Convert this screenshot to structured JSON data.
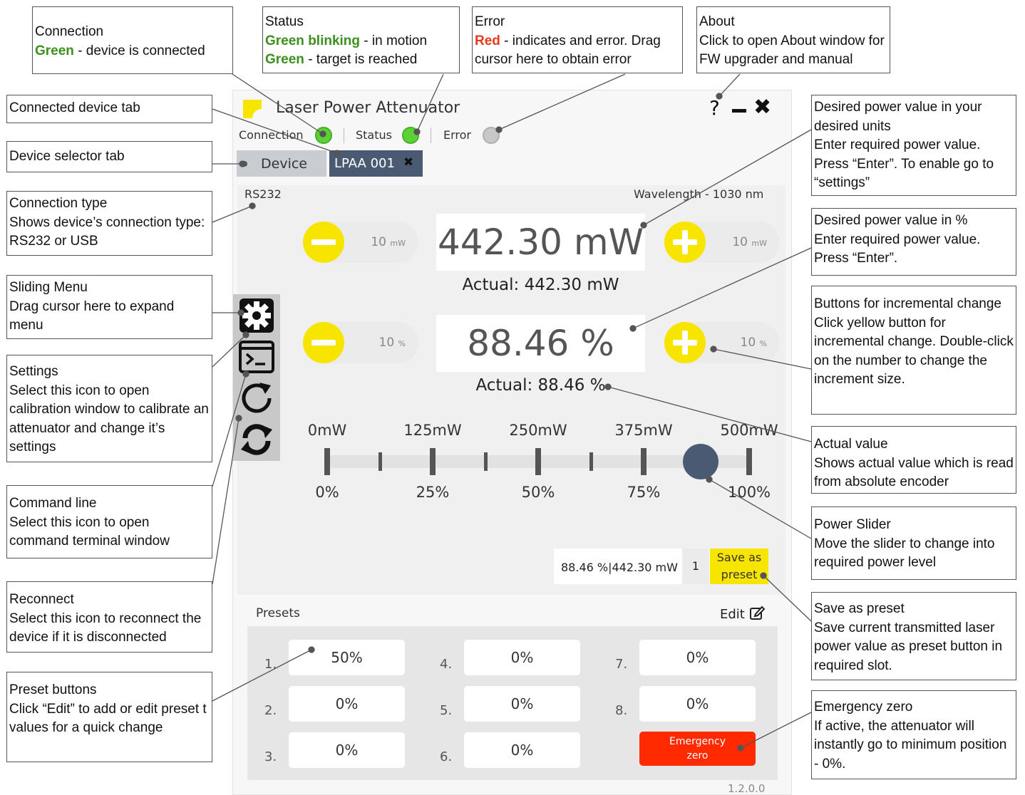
{
  "app": {
    "title": "Laser Power Attenuator",
    "help_glyph": "?",
    "indicators": {
      "connection_label": "Connection",
      "status_label": "Status",
      "error_label": "Error"
    },
    "tabs": {
      "device": "Device",
      "connected": "LPAA 001"
    },
    "connection_type": "RS232",
    "wavelength": "Wavelength - 1030 nm",
    "power": {
      "value": "442.30 mW",
      "actual": "Actual: 442.30 mW",
      "minus_step": "10",
      "plus_step": "10",
      "unit": "mW"
    },
    "percent": {
      "value": "88.46 %",
      "actual": "Actual: 88.46 %",
      "minus_step": "10",
      "plus_step": "10",
      "unit": "%"
    },
    "slider": {
      "top_labels": [
        "0mW",
        "125mW",
        "250mW",
        "375mW",
        "500mW"
      ],
      "bottom_labels": [
        "0%",
        "25%",
        "50%",
        "75%",
        "100%"
      ],
      "value_percent": 88.46
    },
    "save_bar": {
      "readout": "88.46 %|442.30 mW",
      "slot": "1",
      "save_label": "Save as preset"
    },
    "presets": {
      "title": "Presets",
      "edit_label": "Edit",
      "items": [
        {
          "num": "1.",
          "value": "50%"
        },
        {
          "num": "2.",
          "value": "0%"
        },
        {
          "num": "3.",
          "value": "0%"
        },
        {
          "num": "4.",
          "value": "0%"
        },
        {
          "num": "5.",
          "value": "0%"
        },
        {
          "num": "6.",
          "value": "0%"
        },
        {
          "num": "7.",
          "value": "0%"
        },
        {
          "num": "8.",
          "value": "0%"
        }
      ],
      "emergency_label": "Emergency zero"
    },
    "version": "1.2.0.0",
    "colors": {
      "yellow": "#f7e500",
      "green": "#5bd136",
      "error_grey": "#c8c8c8",
      "emergency": "#ff2a00",
      "tab_dark": "#4a5a72",
      "knob": "#4a5a72"
    }
  },
  "callouts": {
    "connection": {
      "title": "Connection",
      "green": "Green",
      "desc": " - device is connected"
    },
    "status": {
      "title": "Status",
      "green_blink": "Green blinking",
      "desc1": " - in motion",
      "green": "Green",
      "desc2": " - target is reached"
    },
    "error": {
      "title": "Error",
      "red": "Red",
      "desc": " - indicates and error. Drag cursor here to obtain error"
    },
    "about": {
      "title": "About",
      "desc": "Click to open About window for FW upgrader and manual"
    },
    "connected_tab": {
      "title": "Connected device tab"
    },
    "selector_tab": {
      "title": "Device selector tab"
    },
    "conn_type": {
      "title": "Connection type",
      "desc": "Shows device’s connection type: RS232 or USB"
    },
    "sliding_menu": {
      "title": "Sliding Menu",
      "desc": "Drag cursor here to expand menu"
    },
    "settings": {
      "title": "Settings",
      "desc": "Select this icon to open calibration window to calibrate an attenuator and change it’s settings"
    },
    "command_line": {
      "title": "Command line",
      "desc": "Select this icon to open command terminal window"
    },
    "reconnect": {
      "title": "Reconnect",
      "desc": "Select this icon to reconnect the device if it is disconnected"
    },
    "preset_buttons": {
      "title": "Preset buttons",
      "desc": "Click “Edit” to add or edit preset t values for a quick change"
    },
    "desired_units": {
      "title": "Desired power value in your desired units",
      "desc": "Enter required power value. Press “Enter”. To enable go to “settings”"
    },
    "desired_pct": {
      "title": "Desired power value in %",
      "desc": "Enter required power value. Press “Enter”."
    },
    "incr_buttons": {
      "title": "Buttons for incremental change",
      "desc": "Click yellow button for incremental change. Double-click on the number to change the increment size."
    },
    "actual": {
      "title": "Actual value",
      "desc": "Shows actual value which is read from absolute encoder"
    },
    "slider": {
      "title": "Power Slider",
      "desc": "Move the slider to change into required power level"
    },
    "save_preset": {
      "title": "Save as preset",
      "desc": "Save current transmitted laser power value as preset button in required slot."
    },
    "emergency": {
      "title": "Emergency zero",
      "desc": "If active, the attenuator will instantly go to minimum position - 0%."
    }
  }
}
